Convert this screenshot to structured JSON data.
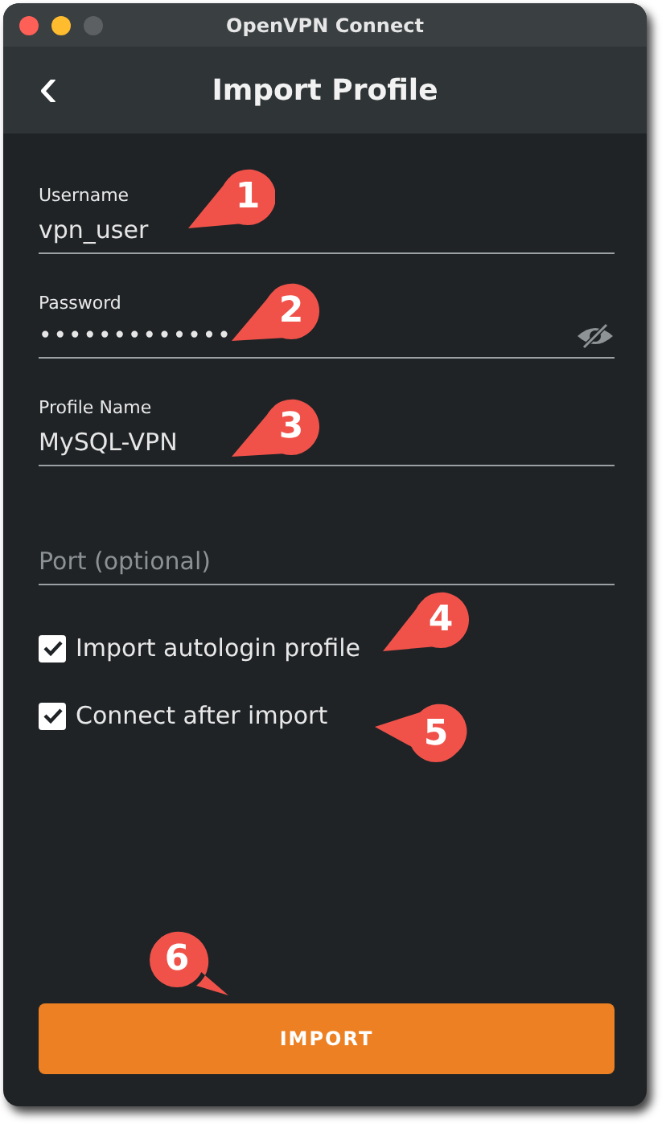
{
  "window": {
    "title": "OpenVPN Connect"
  },
  "header": {
    "back_icon": "‹",
    "title": "Import Profile"
  },
  "fields": [
    {
      "kind": "text",
      "label": "Username",
      "value": "vpn_user"
    },
    {
      "kind": "password",
      "label": "Password",
      "value": "•••••••••••••"
    },
    {
      "kind": "text",
      "label": "Profile Name",
      "value": "MySQL-VPN"
    },
    {
      "kind": "text",
      "placeholder": "Port (optional)"
    }
  ],
  "checkboxes": [
    {
      "label": "Import autologin profile",
      "checked": true
    },
    {
      "label": "Connect after import",
      "checked": true
    }
  ],
  "import_button": "IMPORT",
  "callouts": [
    "1",
    "2",
    "3",
    "4",
    "5",
    "6"
  ]
}
